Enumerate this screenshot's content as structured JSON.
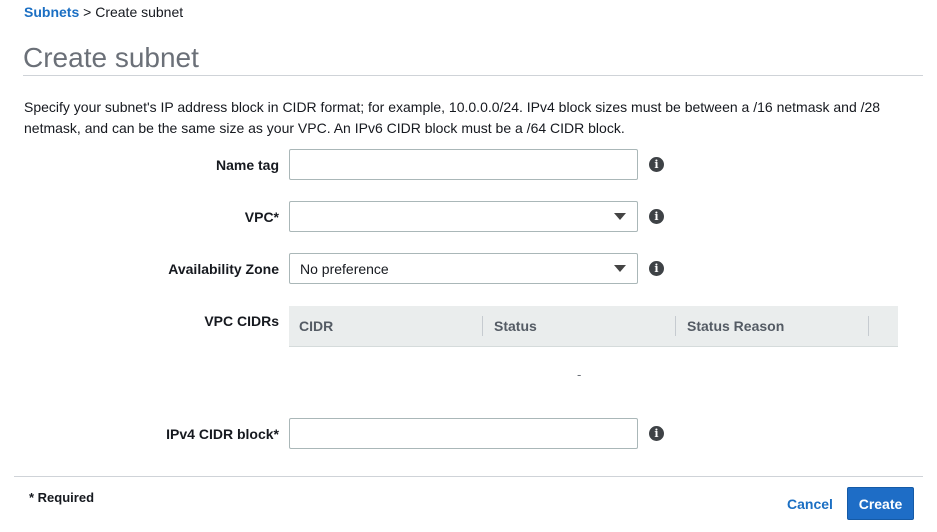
{
  "breadcrumb": {
    "link": "Subnets",
    "separator": ">",
    "current": "Create subnet"
  },
  "page": {
    "title": "Create subnet",
    "description": "Specify your subnet's IP address block in CIDR format; for example, 10.0.0.0/24. IPv4 block sizes must be between a /16 netmask and /28 netmask, and can be the same size as your VPC. An IPv6 CIDR block must be a /64 CIDR block."
  },
  "form": {
    "name_tag": {
      "label": "Name tag",
      "value": "",
      "info_icon": "info-icon"
    },
    "vpc": {
      "label": "VPC*",
      "value": "",
      "info_icon": "info-icon"
    },
    "availability_zone": {
      "label": "Availability Zone",
      "value": "No preference",
      "info_icon": "info-icon"
    },
    "vpc_cidrs": {
      "label": "VPC CIDRs",
      "columns": [
        "CIDR",
        "Status",
        "Status Reason"
      ],
      "empty_text": "-"
    },
    "ipv4_cidr": {
      "label": "IPv4 CIDR block*",
      "value": "",
      "info_icon": "info-icon"
    }
  },
  "footer": {
    "required_note": "* Required",
    "cancel_label": "Cancel",
    "create_label": "Create"
  },
  "colors": {
    "link": "#1b6fc3",
    "primary_button": "#1e6dc6",
    "table_header": "#eaeded"
  }
}
